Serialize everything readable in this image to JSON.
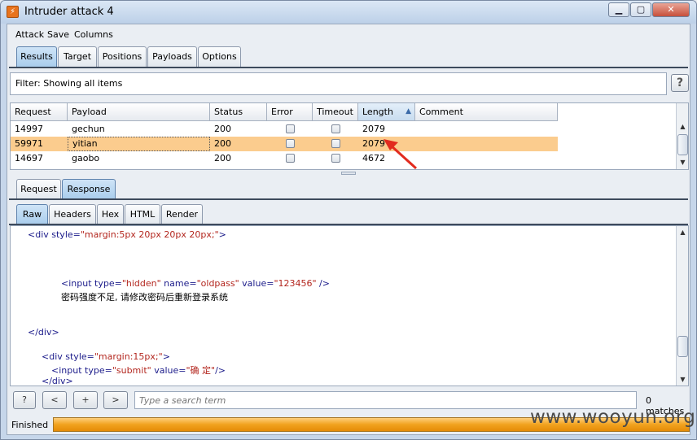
{
  "window": {
    "title": "Intruder attack 4"
  },
  "menu": [
    "Attack",
    "Save",
    "Columns"
  ],
  "main_tabs": [
    {
      "label": "Results",
      "active": true
    },
    {
      "label": "Target",
      "active": false
    },
    {
      "label": "Positions",
      "active": false
    },
    {
      "label": "Payloads",
      "active": false
    },
    {
      "label": "Options",
      "active": false
    }
  ],
  "filter": {
    "text": "Filter:  Showing all items",
    "help": "?"
  },
  "results_table": {
    "columns": [
      "Request",
      "Payload",
      "Status",
      "Error",
      "Timeout",
      "Length",
      "Comment"
    ],
    "sorted_column": "Length",
    "rows": [
      {
        "request": "14997",
        "payload": "gechun",
        "status": "200",
        "error": false,
        "timeout": false,
        "length": "2079",
        "comment": "",
        "selected": false
      },
      {
        "request": "59971",
        "payload": "yitian",
        "status": "200",
        "error": false,
        "timeout": false,
        "length": "2079",
        "comment": "",
        "selected": true
      },
      {
        "request": "14697",
        "payload": "gaobo",
        "status": "200",
        "error": false,
        "timeout": false,
        "length": "4672",
        "comment": "",
        "selected": false
      }
    ]
  },
  "message_tabs": [
    {
      "label": "Request",
      "active": false
    },
    {
      "label": "Response",
      "active": true
    }
  ],
  "view_tabs": [
    {
      "label": "Raw",
      "active": true
    },
    {
      "label": "Headers",
      "active": false
    },
    {
      "label": "Hex",
      "active": false
    },
    {
      "label": "HTML",
      "active": false
    },
    {
      "label": "Render",
      "active": false
    }
  ],
  "response_lines": {
    "l1_tag": "<div",
    "l1_attr": " style=",
    "l1_val": "\"margin:5px 20px 20px 20px;\"",
    "l1_end": ">",
    "l2_tag": "<input",
    "l2_a1": " type=",
    "l2_v1": "\"hidden\"",
    "l2_a2": " name=",
    "l2_v2": "\"oldpass\"",
    "l2_a3": " value=",
    "l2_v3": "\"123456\"",
    "l2_end": " />",
    "l3_text": "密码强度不足, 请修改密码后重新登录系统",
    "l4_tag": "</div>",
    "l5_tag": "<div",
    "l5_attr": " style=",
    "l5_val": "\"margin:15px;\"",
    "l5_end": ">",
    "l6_tag": "<input",
    "l6_a1": " type=",
    "l6_v1": "\"submit\"",
    "l6_a2": " value=",
    "l6_v2": "\"确 定\"",
    "l6_end": "/>",
    "l7_tag": "</div>"
  },
  "search": {
    "help": "?",
    "prev": "<",
    "add": "+",
    "next": ">",
    "placeholder": "Type a search term",
    "matches": "0 matches"
  },
  "status": {
    "text": "Finished",
    "progress": 1.0
  },
  "watermark": "www.wooyun.org",
  "colors": {
    "selected_row": "#fbcc8e",
    "progress": "#f1a21e",
    "active_tab": "#a9cdec"
  }
}
